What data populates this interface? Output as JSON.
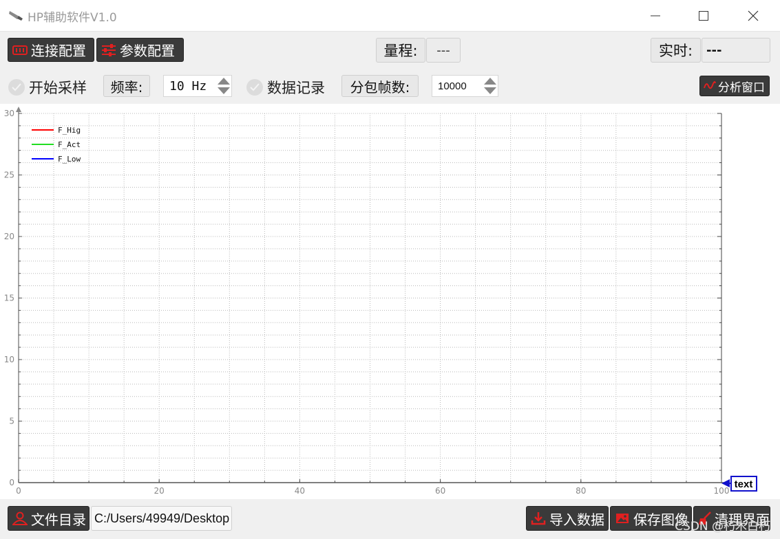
{
  "window": {
    "title": "HP辅助软件V1.0"
  },
  "toolbar1": {
    "connect_label": "连接配置",
    "param_label": "参数配置",
    "range_label": "量程:",
    "range_value": "---",
    "realtime_label": "实时:",
    "realtime_value": "---"
  },
  "toolbar2": {
    "start_sampling_label": "开始采样",
    "freq_label": "频率:",
    "freq_value": "10 Hz",
    "data_record_label": "数据记录",
    "frames_label": "分包帧数:",
    "frames_value": "10000",
    "analysis_label": "分析窗口"
  },
  "chart_data": {
    "type": "line",
    "xlim": [
      0,
      100
    ],
    "ylim": [
      0,
      30
    ],
    "xticks": [
      "0",
      "20",
      "40",
      "60",
      "80",
      "100"
    ],
    "yticks": [
      "0",
      "5",
      "10",
      "15",
      "20",
      "25",
      "30"
    ],
    "grid": true,
    "legend_position": "top-left",
    "series": [
      {
        "name": "F_Hig",
        "color": "#ff0000",
        "values": []
      },
      {
        "name": "F_Act",
        "color": "#22dd22",
        "values": []
      },
      {
        "name": "F_Low",
        "color": "#0000ff",
        "values": []
      }
    ],
    "cursor_label": "text"
  },
  "bottom": {
    "file_dir_label": "文件目录",
    "path_value": "C:/Users/49949/Desktop",
    "import_label": "导入数据",
    "save_image_label": "保存图像",
    "clear_label": "清理界面"
  },
  "watermark": "CSDN @朽木白朽",
  "colors": {
    "accent_red": "#e02020",
    "button_dark": "#3a3a3a"
  }
}
